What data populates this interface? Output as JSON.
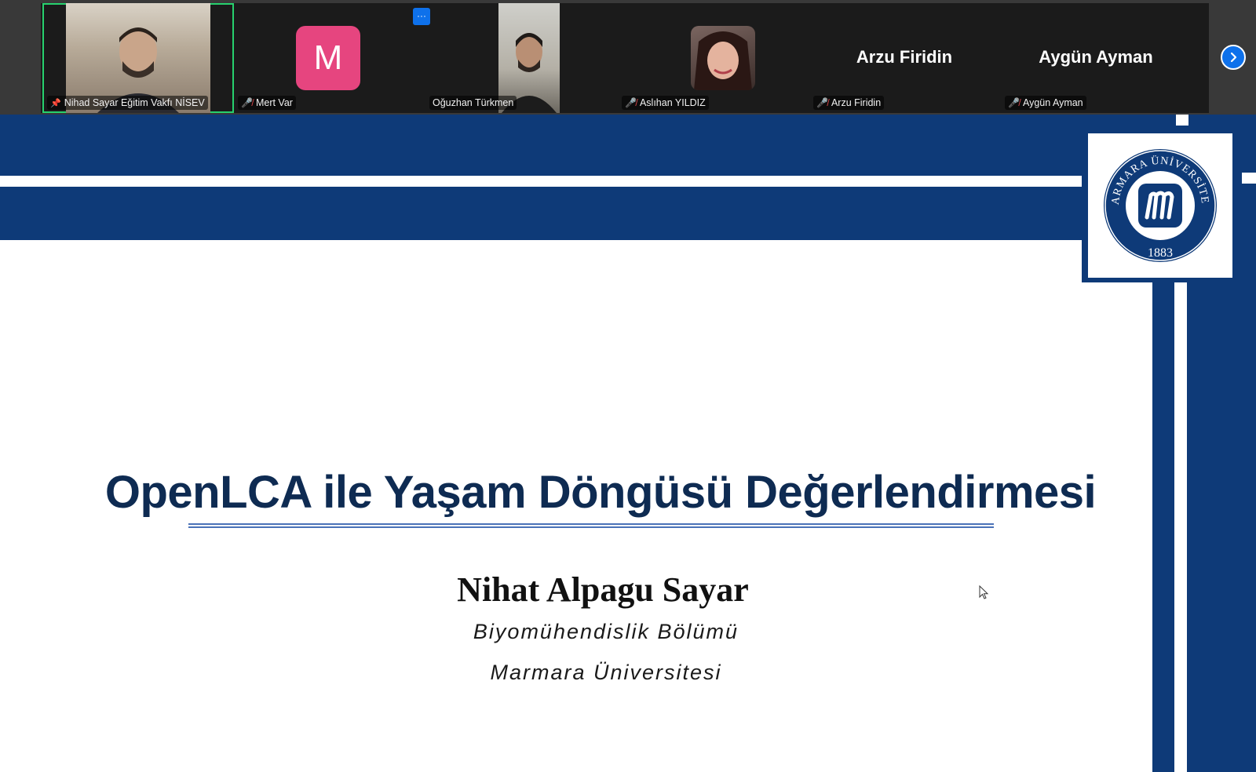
{
  "participants": [
    {
      "name": "Nihad Sayar Eğitim Vakfı NİSEV",
      "pinned": true,
      "active": true,
      "video": true
    },
    {
      "name": "Mert Var",
      "muted": true,
      "avatar_letter": "M",
      "avatar_color": "#e6457f"
    },
    {
      "name": "Oğuzhan Türkmen",
      "video": true
    },
    {
      "name": "Aslıhan YILDIZ",
      "muted": true,
      "photo": true
    },
    {
      "name": "Arzu Firidin",
      "muted": true,
      "display_name": "Arzu Firidin"
    },
    {
      "name": "Aygün Ayman",
      "muted": true,
      "display_name": "Aygün Ayman"
    }
  ],
  "controls": {
    "more_label": "···",
    "next_icon": "chevron-right-icon"
  },
  "slide": {
    "title": "OpenLCA ile Yaşam Döngüsü Değerlendirmesi",
    "author": "Nihat Alpagu Sayar",
    "department": "Biyomühendislik Bölümü",
    "university": "Marmara Üniversitesi",
    "logo_text": "MARMARA ÜNİVERSİTESİ",
    "logo_year": "1883",
    "brand_color": "#0e3a78"
  }
}
